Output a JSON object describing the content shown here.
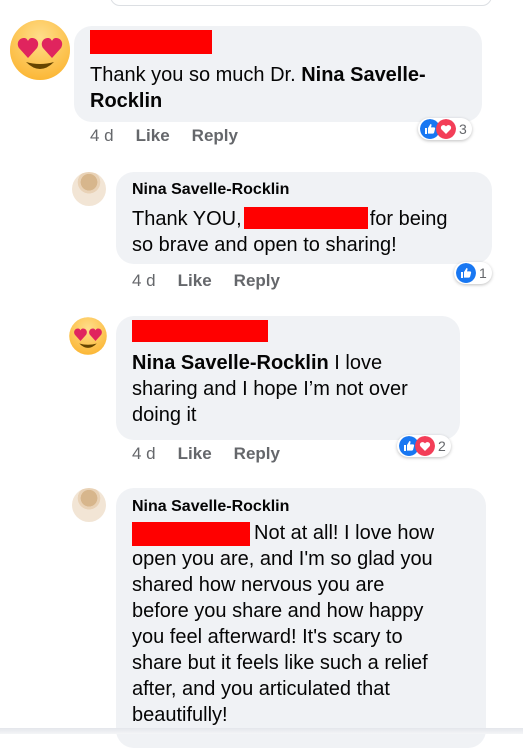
{
  "comments": [
    {
      "text_plain": "Thank you so much Dr. ",
      "text_bold": "Nina Savelle-",
      "text_bold_2": "Rocklin",
      "time": "4 d",
      "like": "Like",
      "reply": "Reply",
      "reaction_count": "3"
    },
    {
      "author": "Nina Savelle-Rocklin",
      "text_line1_a": "Thank YOU,",
      "text_line1_b": "for being",
      "text_line2": "so brave and open to sharing!",
      "time": "4 d",
      "like": "Like",
      "reply": "Reply",
      "reaction_count": "1"
    },
    {
      "text_bold": "Nina Savelle-Rocklin",
      "text_line1_rest": " I love",
      "text_line2": "sharing and I hope I’m not over",
      "text_line3": "doing it",
      "time": "4 d",
      "like": "Like",
      "reply": "Reply",
      "reaction_count": "2"
    },
    {
      "author": "Nina Savelle-Rocklin",
      "lines": [
        "Not at all! I love how",
        "open you are, and I'm so glad you",
        "shared how nervous you are",
        "before you share and how happy",
        "you feel afterward! It's scary to",
        "share but it feels like such a relief",
        "after, and you articulated that",
        "beautifully!"
      ]
    }
  ],
  "colors": {
    "redaction": "#ff0000",
    "bubble": "#f0f2f5",
    "like_blue": "#1877f2",
    "love_red": "#f33e58",
    "meta_gray": "#65676b"
  },
  "icons": [
    "heart-eyes-emoji-icon",
    "like-reaction-icon",
    "love-reaction-icon"
  ]
}
